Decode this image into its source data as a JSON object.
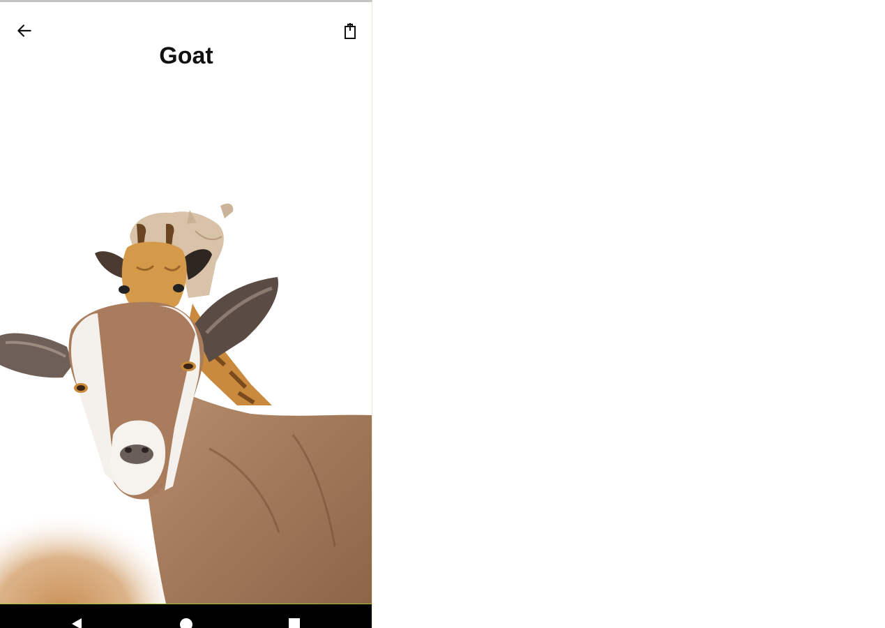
{
  "app": {
    "title": "Goat"
  },
  "toolbar": {
    "back_icon": "arrow-left-icon",
    "share_icon": "share-icon"
  },
  "illustration": {
    "subject": "goat-giraffe-rhino-illustration",
    "colors": {
      "goat_brown": "#a5785a",
      "giraffe_orange": "#d49a4a",
      "rhino_beige": "#d8c2a8",
      "ground": "#d3a97a"
    }
  },
  "navbar": {
    "back_icon": "nav-back-icon",
    "home_icon": "nav-home-icon",
    "recents_icon": "nav-recents-icon"
  }
}
